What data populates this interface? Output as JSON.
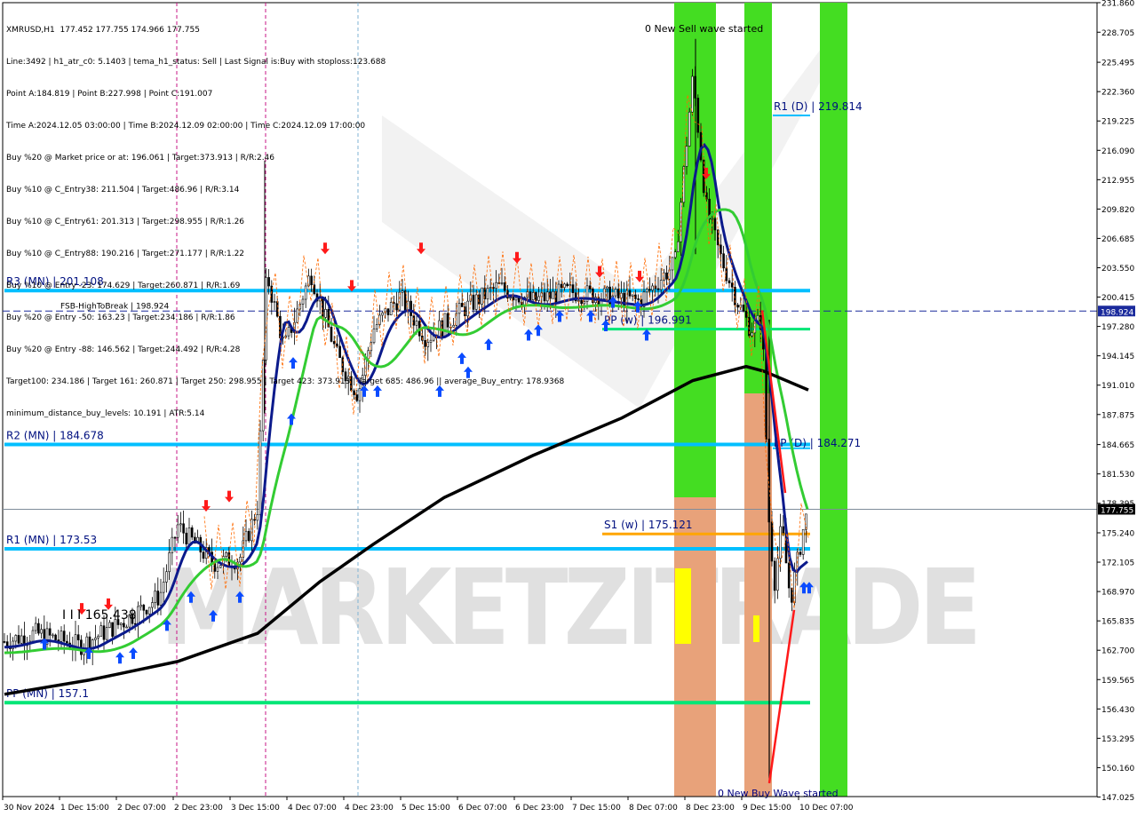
{
  "chart_data": {
    "type": "candlestick",
    "symbol_line": "XMRUSD,H1  177.452 177.755 174.966 177.755",
    "current_price": 177.755,
    "ylim": [
      147.07,
      231.86
    ],
    "y_ticks": [
      "231.860",
      "228.705",
      "225.495",
      "222.360",
      "219.225",
      "216.090",
      "212.955",
      "209.820",
      "206.685",
      "203.550",
      "200.415",
      "197.280",
      "194.145",
      "191.010",
      "187.875",
      "184.665",
      "181.530",
      "178.395",
      "175.240",
      "172.105",
      "168.970",
      "165.835",
      "162.700",
      "159.565",
      "156.430",
      "153.295",
      "150.160",
      "147.025"
    ],
    "x_ticks": [
      "30 Nov 2024",
      "1 Dec 15:00",
      "2 Dec 07:00",
      "2 Dec 23:00",
      "3 Dec 15:00",
      "4 Dec 07:00",
      "4 Dec 23:00",
      "5 Dec 15:00",
      "6 Dec 07:00",
      "6 Dec 23:00",
      "7 Dec 15:00",
      "8 Dec 07:00",
      "8 Dec 23:00",
      "9 Dec 15:00",
      "10 Dec 07:00"
    ],
    "info_lines": [
      "Line:3492 | h1_atr_c0: 5.1403 | tema_h1_status: Sell | Last Signal is:Buy with stoploss:123.688",
      "Point A:184.819 | Point B:227.998 | Point C:191.007",
      "Time A:2024.12.05 03:00:00 | Time B:2024.12.09 02:00:00 | Time C:2024.12.09 17:00:00",
      "Buy %20 @ Market price or at: 196.061 | Target:373.913 | R/R:2.46",
      "Buy %10 @ C_Entry38: 211.504 | Target:486.96 | R/R:3.14",
      "Buy %10 @ C_Entry61: 201.313 | Target:298.955 | R/R:1.26",
      "Buy %10 @ C_Entry88: 190.216 | Target:271.177 | R/R:1.22",
      "Buy %10 @ Entry -23: 174.629 | Target:260.871 | R/R:1.69",
      "Buy %20 @ Entry -50: 163.23 | Target:234.186 | R/R:1.86",
      "Buy %20 @ Entry -88: 146.562 | Target:244.492 | R/R:4.28",
      "Target100: 234.186 | Target 161: 260.871 | Target 250: 298.955 | Target 423: 373.913 | Target 685: 486.96 || average_Buy_entry: 178.9368",
      "minimum_distance_buy_levels: 10.191 | ATR:5.14"
    ],
    "levels": [
      {
        "label": "R3 (MN) | 201.108",
        "value": 201.108,
        "color": "#00bfff"
      },
      {
        "label": "R2 (MN) | 184.678",
        "value": 184.678,
        "color": "#00bfff"
      },
      {
        "label": "R1 (MN) | 173.53",
        "value": 173.53,
        "color": "#00bfff"
      },
      {
        "label": "PP (MN) | 157.1",
        "value": 157.1,
        "color": "#00e676"
      },
      {
        "label": "PP (w) | 196.991",
        "value": 196.991,
        "color": "#00e676"
      },
      {
        "label": "S1 (w) | 175.121",
        "value": 175.121,
        "color": "#ffa500"
      },
      {
        "label": "R1 (D) | 219.814",
        "value": 219.814,
        "color": "#00bfff"
      },
      {
        "label": "PP (D) | 184.271",
        "value": 184.271,
        "color": "#00bfff"
      }
    ],
    "fsb_label": "FSB-HighToBreak | 198.924",
    "fsb_value": 198.924,
    "fsb_tag": "198.924",
    "price_tag": "177.755",
    "annotations": {
      "sell_wave": "0 New Sell wave started",
      "buy_wave": "0 New Buy Wave started",
      "low_marker": "I I I 165.438"
    },
    "watermark": "MARKETZITRADE",
    "colors": {
      "candle": "#000000",
      "ema_blue": "#0b1a8c",
      "ema_green": "#33cc33",
      "sma_black": "#000000",
      "buy_arrow": "#0a4bff",
      "sell_arrow": "#ff1a1a",
      "zone_green": "#44dd22",
      "zone_orange": "#e8a27a",
      "zone_yellow": "#ffff00"
    }
  }
}
